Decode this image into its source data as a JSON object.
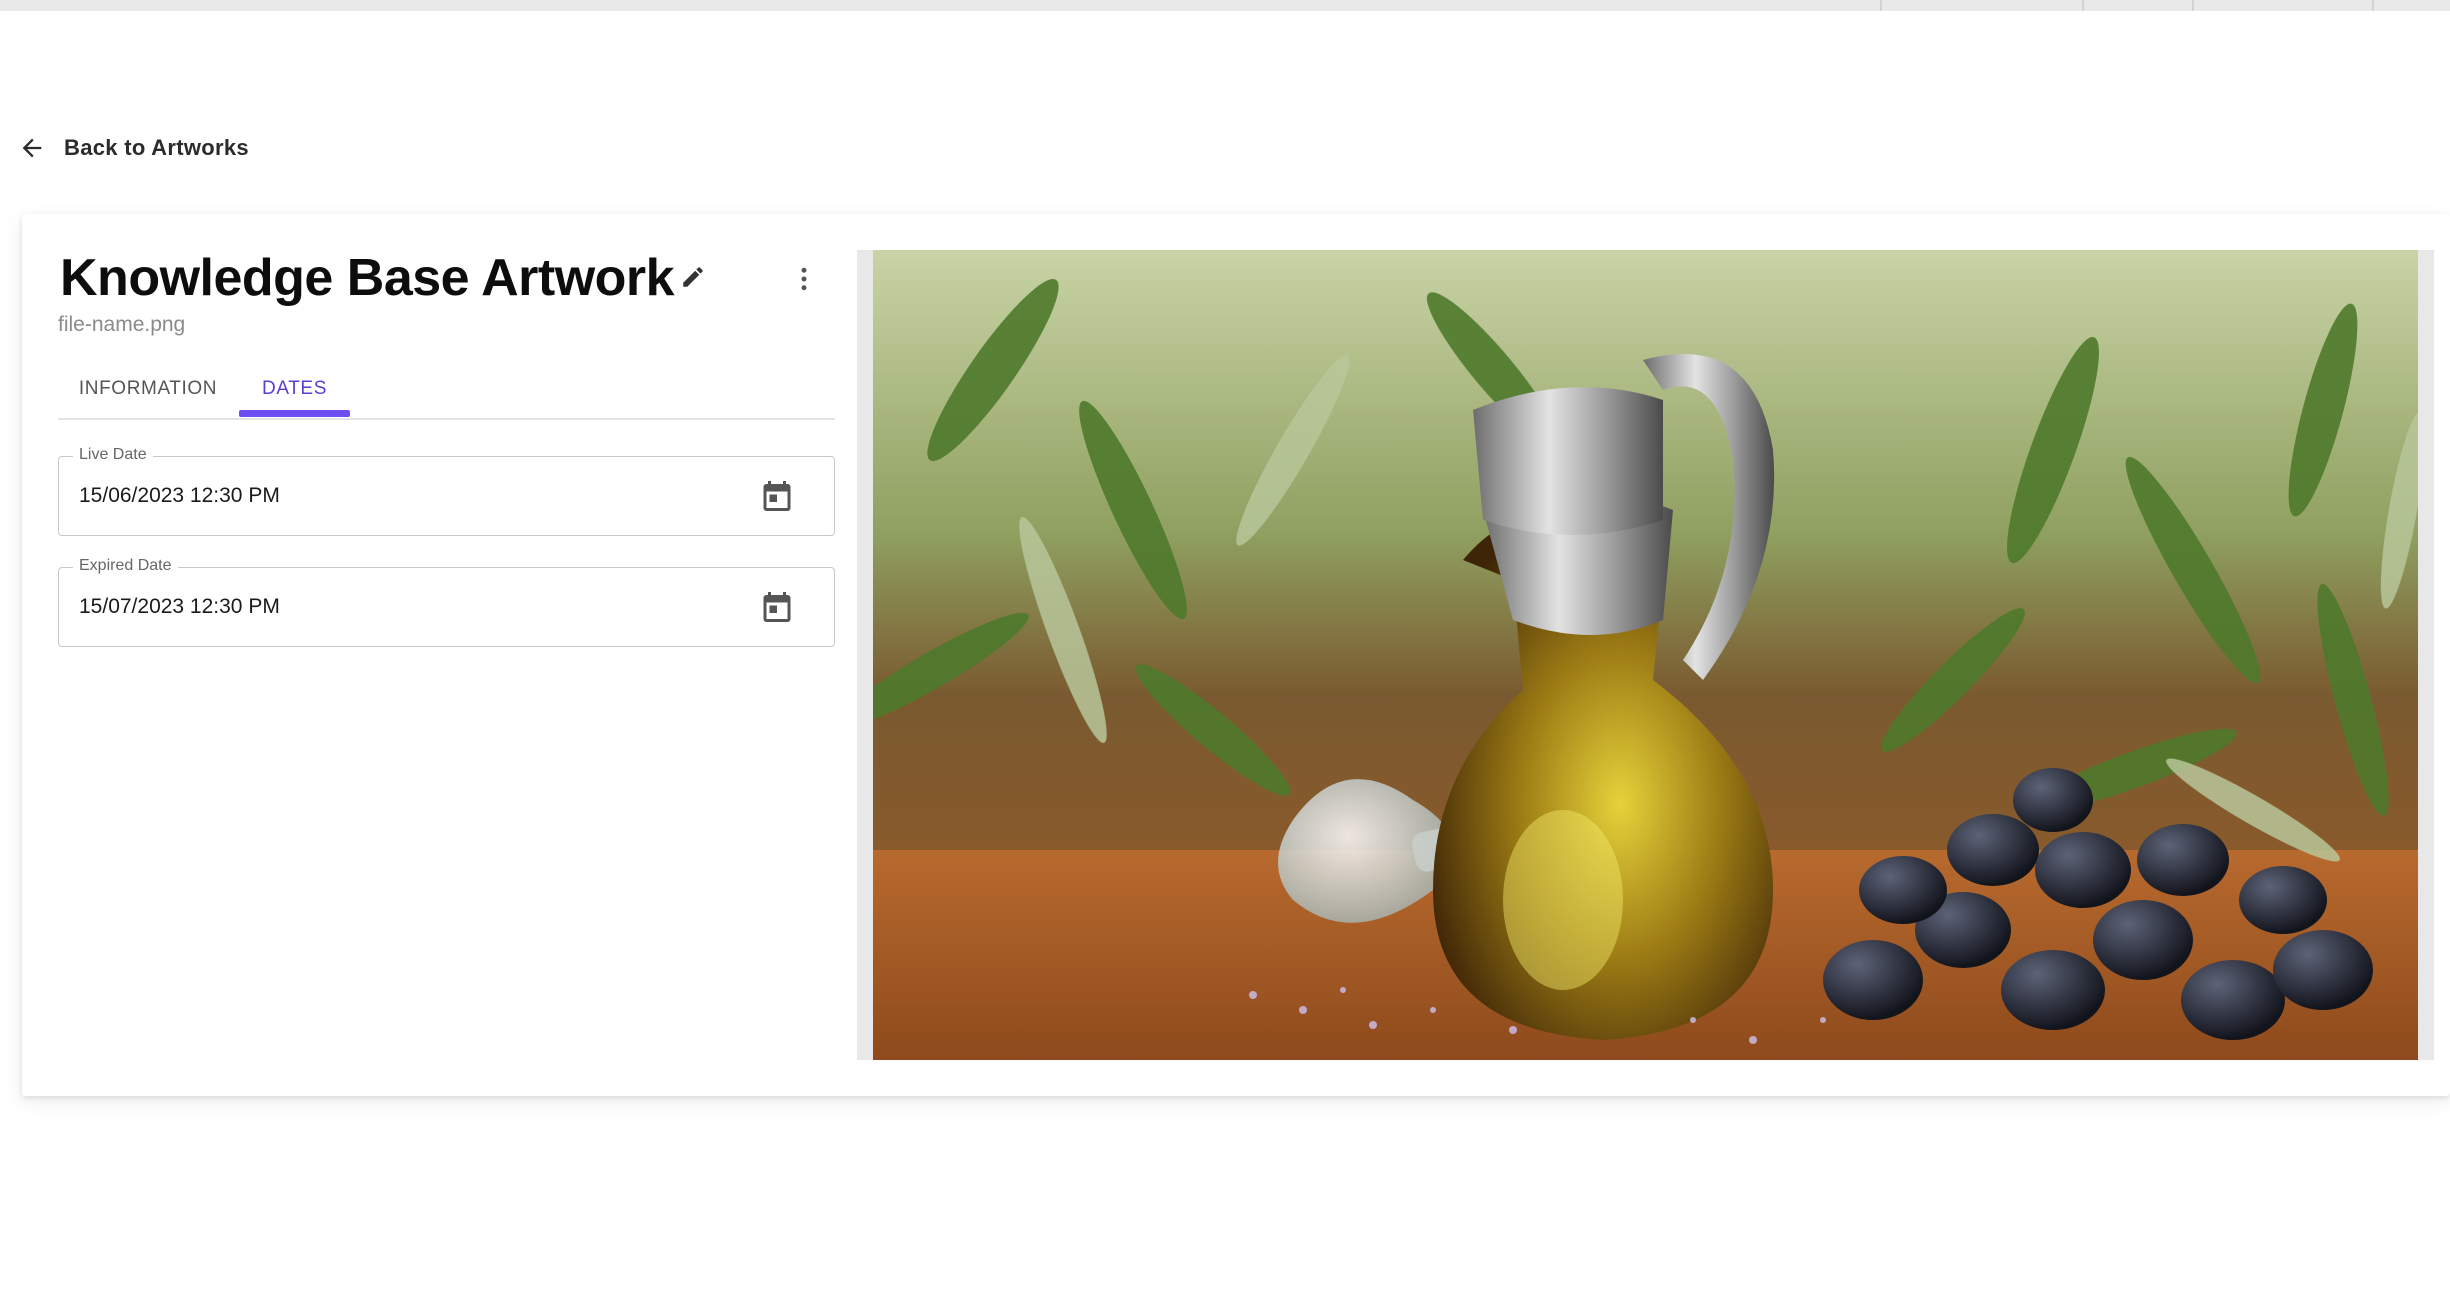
{
  "nav": {
    "back_label": "Back to Artworks"
  },
  "artwork": {
    "title": "Knowledge Base Artwork",
    "filename": "file-name.png"
  },
  "tabs": [
    {
      "label": "INFORMATION",
      "active": false
    },
    {
      "label": "DATES",
      "active": true
    }
  ],
  "dates": {
    "live": {
      "label": "Live Date",
      "value": "15/06/2023 12:30 PM"
    },
    "expired": {
      "label": "Expired Date",
      "value": "15/07/2023 12:30 PM"
    }
  },
  "icons": {
    "back": "arrow-left-icon",
    "edit": "pencil-icon",
    "more": "more-vert-icon",
    "calendar": "calendar-icon"
  },
  "colors": {
    "accent": "#6c4ef2",
    "active_tab_text": "#5b3ed6"
  }
}
